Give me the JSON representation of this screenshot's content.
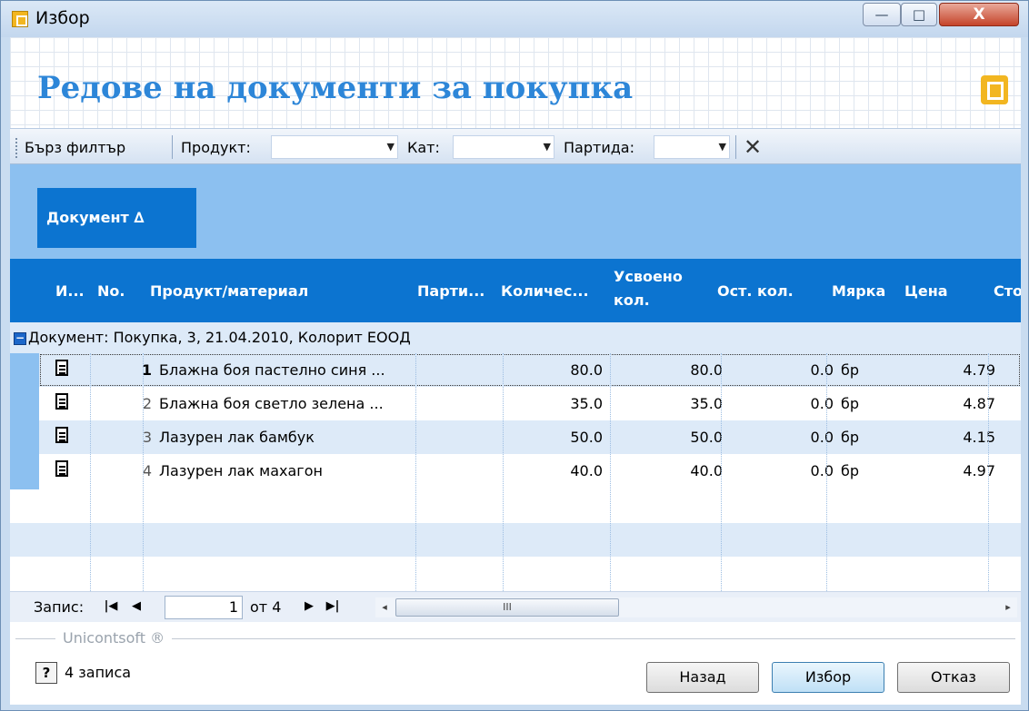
{
  "window": {
    "title": "Избор",
    "controls": {
      "min": "—",
      "max": "□",
      "close": "X"
    }
  },
  "header": {
    "title": "Редове на документи за покупка"
  },
  "filterbar": {
    "quick_filter": "Бърз филтър",
    "product_label": "Продукт:",
    "cat_label": "Кат:",
    "batch_label": "Партида:",
    "product_value": "",
    "cat_value": "",
    "batch_value": "",
    "clear": "✕"
  },
  "group_panel": {
    "chip": "Документ ∆"
  },
  "columns": {
    "i": "И...",
    "no": "No.",
    "product": "Продукт/материал",
    "batch": "Парти...",
    "qty": "Количес...",
    "absorbed_1": "Усвоено",
    "absorbed_2": "кол.",
    "rest": "Ост. кол.",
    "unit": "Мярка",
    "price": "Цена",
    "value": "Сто"
  },
  "group": {
    "expander": "−",
    "text": "Документ: Покупка, 3, 21.04.2010, Колорит ЕООД"
  },
  "rows": [
    {
      "no": "1",
      "product": "Блажна боя пастелно синя ...",
      "qty": "80.0",
      "absorbed": "80.0",
      "rest": "0.0",
      "unit": "бр",
      "price": "4.79"
    },
    {
      "no": "2",
      "product": "Блажна боя светло зелена ...",
      "qty": "35.0",
      "absorbed": "35.0",
      "rest": "0.0",
      "unit": "бр",
      "price": "4.87"
    },
    {
      "no": "3",
      "product": "Лазурен лак бамбук",
      "qty": "50.0",
      "absorbed": "50.0",
      "rest": "0.0",
      "unit": "бр",
      "price": "4.15"
    },
    {
      "no": "4",
      "product": "Лазурен лак махагон",
      "qty": "40.0",
      "absorbed": "40.0",
      "rest": "0.0",
      "unit": "бр",
      "price": "4.97"
    }
  ],
  "navigator": {
    "label": "Запис:",
    "first": "|◀",
    "prev": "◀",
    "current": "1",
    "of": "от 4",
    "next": "▶",
    "last": "▶|",
    "scroll_left": "◂",
    "scroll_right": "▸",
    "thumb": "III"
  },
  "footer": {
    "brand": "Unicontsoft ®",
    "help": "?",
    "count": "4 записа",
    "back": "Назад",
    "choose": "Избор",
    "cancel": "Отказ"
  },
  "colors": {
    "accent": "#0c74d0",
    "group_panel": "#8cc0f0",
    "title": "#2d86d8",
    "logo": "#f2b621"
  }
}
